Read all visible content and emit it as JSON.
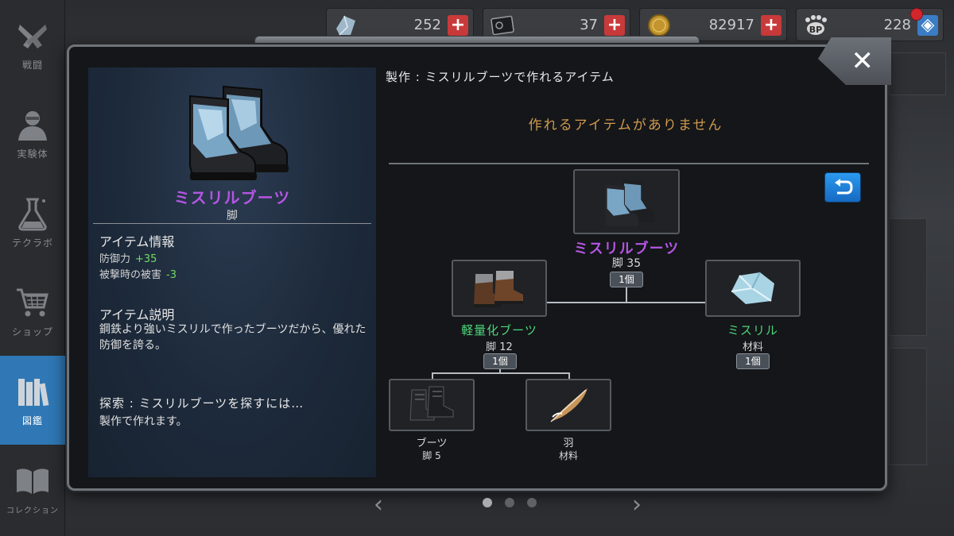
{
  "sidebar": {
    "items": [
      {
        "label": "戦闘",
        "icon": "crossed-guns-icon"
      },
      {
        "label": "実験体",
        "icon": "character-icon"
      },
      {
        "label": "テクラボ",
        "icon": "flask-icon"
      },
      {
        "label": "ショップ",
        "icon": "cart-icon"
      },
      {
        "label": "図鑑",
        "icon": "books-icon"
      },
      {
        "label": "コレクション",
        "icon": "open-book-icon"
      }
    ],
    "active_index": 4
  },
  "resources": [
    {
      "name": "crystal",
      "icon": "crystal-icon",
      "value": "252"
    },
    {
      "name": "ticket",
      "icon": "ticket-icon",
      "value": "37"
    },
    {
      "name": "coin",
      "icon": "coin-icon",
      "value": "82917"
    },
    {
      "name": "bp",
      "icon": "bp-paw-icon",
      "value": "228"
    }
  ],
  "item": {
    "name": "ミスリルブーツ",
    "category": "脚",
    "info_title": "アイテム情報",
    "stats": [
      {
        "label": "防御力",
        "value": "+35"
      },
      {
        "label": "被撃時の被害",
        "value": "-3"
      }
    ],
    "desc_title": "アイテム説明",
    "description": "鋼鉄より強いミスリルで作ったブーツだから、優れた防御を誇る。",
    "search_title": "探索 : ミスリルブーツを探すには…",
    "search_text": "製作で作れます。"
  },
  "crafting": {
    "header": "製作 : ミスリルブーツで作れるアイテム",
    "none_message": "作れるアイテムがありません"
  },
  "tree": {
    "root": {
      "name": "ミスリルブーツ",
      "sub": "脚 35",
      "qty": "1個"
    },
    "left": {
      "name": "軽量化ブーツ",
      "sub": "脚 12",
      "qty": "1個"
    },
    "right": {
      "name": "ミスリル",
      "sub": "材料",
      "qty": "1個"
    },
    "ll": {
      "name": "ブーツ",
      "sub": "脚 5"
    },
    "lr": {
      "name": "羽",
      "sub": "材料"
    }
  },
  "colors": {
    "purple_name": "#b455e3",
    "green_name": "#4ed67a",
    "stat_green": "#6fdc62",
    "none_msg": "#d09a4e",
    "active_tab": "#2f78b5"
  },
  "pager": {
    "prev": "‹",
    "next": "›",
    "total": 3,
    "current": 1
  }
}
